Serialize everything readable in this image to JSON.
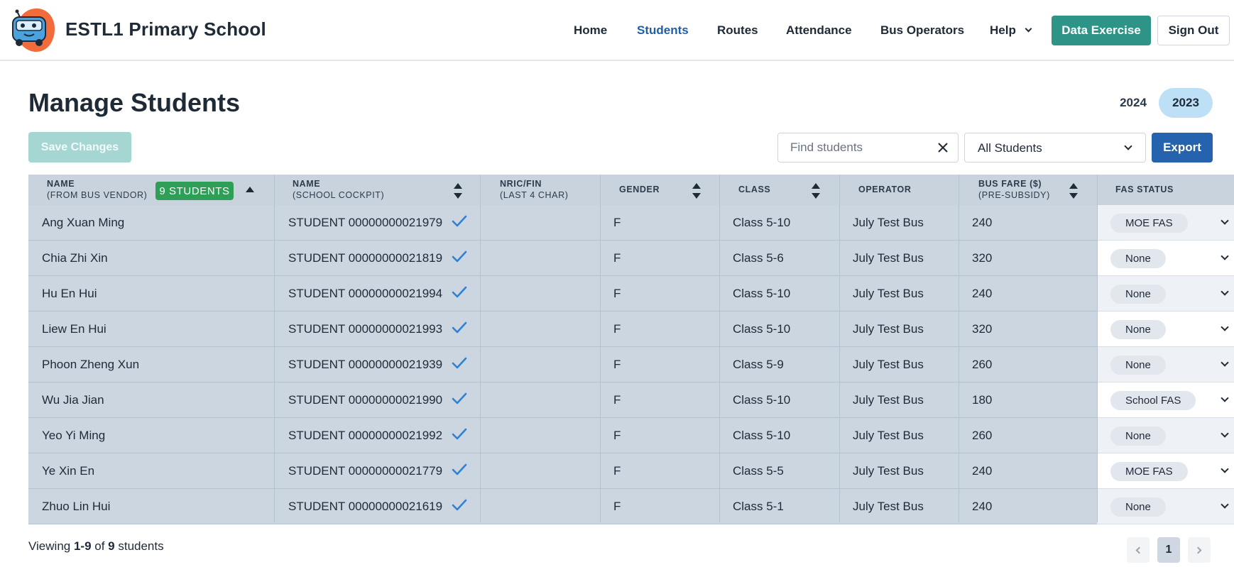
{
  "app": {
    "school_name": "ESTL1 Primary School",
    "nav": [
      {
        "label": "Home"
      },
      {
        "label": "Students",
        "active": true
      },
      {
        "label": "Routes"
      },
      {
        "label": "Attendance"
      },
      {
        "label": "Bus Operators"
      },
      {
        "label": "Help"
      }
    ],
    "data_exercise_label": "Data Exercise",
    "sign_out_label": "Sign Out"
  },
  "page": {
    "title": "Manage Students",
    "years": [
      "2024",
      "2023"
    ],
    "selected_year": "2023",
    "save_label": "Save Changes",
    "search_placeholder": "Find students",
    "search_value": "",
    "filter_value": "All Students",
    "export_label": "Export"
  },
  "table": {
    "headers": {
      "name_vendor": "NAME",
      "name_vendor_sub": "(FROM BUS VENDOR)",
      "student_count": "9 STUDENTS",
      "name_cockpit": "NAME",
      "name_cockpit_sub": "(SCHOOL COCKPIT)",
      "nric": "NRIC/FIN",
      "nric_sub": "(LAST 4 CHAR)",
      "gender": "GENDER",
      "class": "CLASS",
      "operator": "OPERATOR",
      "fare": "BUS FARE ($)",
      "fare_sub": "(PRE-SUBSIDY)",
      "fas": "FAS STATUS"
    },
    "rows": [
      {
        "vendor_name": "Ang Xuan Ming",
        "cockpit_name": "STUDENT 00000000021979",
        "nric": "",
        "gender": "F",
        "class": "Class 5-10",
        "operator": "July Test Bus",
        "fare": "240",
        "fas": "MOE FAS"
      },
      {
        "vendor_name": "Chia Zhi Xin",
        "cockpit_name": "STUDENT 00000000021819",
        "nric": "",
        "gender": "F",
        "class": "Class 5-6",
        "operator": "July Test Bus",
        "fare": "320",
        "fas": "None"
      },
      {
        "vendor_name": "Hu En Hui",
        "cockpit_name": "STUDENT 00000000021994",
        "nric": "",
        "gender": "F",
        "class": "Class 5-10",
        "operator": "July Test Bus",
        "fare": "240",
        "fas": "None"
      },
      {
        "vendor_name": "Liew En Hui",
        "cockpit_name": "STUDENT 00000000021993",
        "nric": "",
        "gender": "F",
        "class": "Class 5-10",
        "operator": "July Test Bus",
        "fare": "320",
        "fas": "None"
      },
      {
        "vendor_name": "Phoon Zheng Xun",
        "cockpit_name": "STUDENT 00000000021939",
        "nric": "",
        "gender": "F",
        "class": "Class 5-9",
        "operator": "July Test Bus",
        "fare": "260",
        "fas": "None"
      },
      {
        "vendor_name": "Wu Jia Jian",
        "cockpit_name": "STUDENT 00000000021990",
        "nric": "",
        "gender": "F",
        "class": "Class 5-10",
        "operator": "July Test Bus",
        "fare": "180",
        "fas": "School FAS"
      },
      {
        "vendor_name": "Yeo Yi Ming",
        "cockpit_name": "STUDENT 00000000021992",
        "nric": "",
        "gender": "F",
        "class": "Class 5-10",
        "operator": "July Test Bus",
        "fare": "260",
        "fas": "None"
      },
      {
        "vendor_name": "Ye Xin En",
        "cockpit_name": "STUDENT 00000000021779",
        "nric": "",
        "gender": "F",
        "class": "Class 5-5",
        "operator": "July Test Bus",
        "fare": "240",
        "fas": "MOE FAS"
      },
      {
        "vendor_name": "Zhuo Lin Hui",
        "cockpit_name": "STUDENT 00000000021619",
        "nric": "",
        "gender": "F",
        "class": "Class 5-1",
        "operator": "July Test Bus",
        "fare": "240",
        "fas": "None"
      }
    ]
  },
  "footer": {
    "viewing_prefix": "Viewing ",
    "viewing_range": "1-9",
    "viewing_of": " of ",
    "viewing_total": "9",
    "viewing_suffix": " students",
    "current_page": "1"
  },
  "colors": {
    "brand_teal": "#2f9488",
    "nav_active": "#1f5fa6",
    "export_blue": "#2563ae",
    "count_badge": "#2f9e56",
    "check_blue": "#2f80d6"
  },
  "icons": {
    "logo": "bus-mascot-logo",
    "clear": "close-icon",
    "sort": "sort-icon",
    "verified": "check-icon",
    "dropdown": "chevron-down-icon"
  }
}
